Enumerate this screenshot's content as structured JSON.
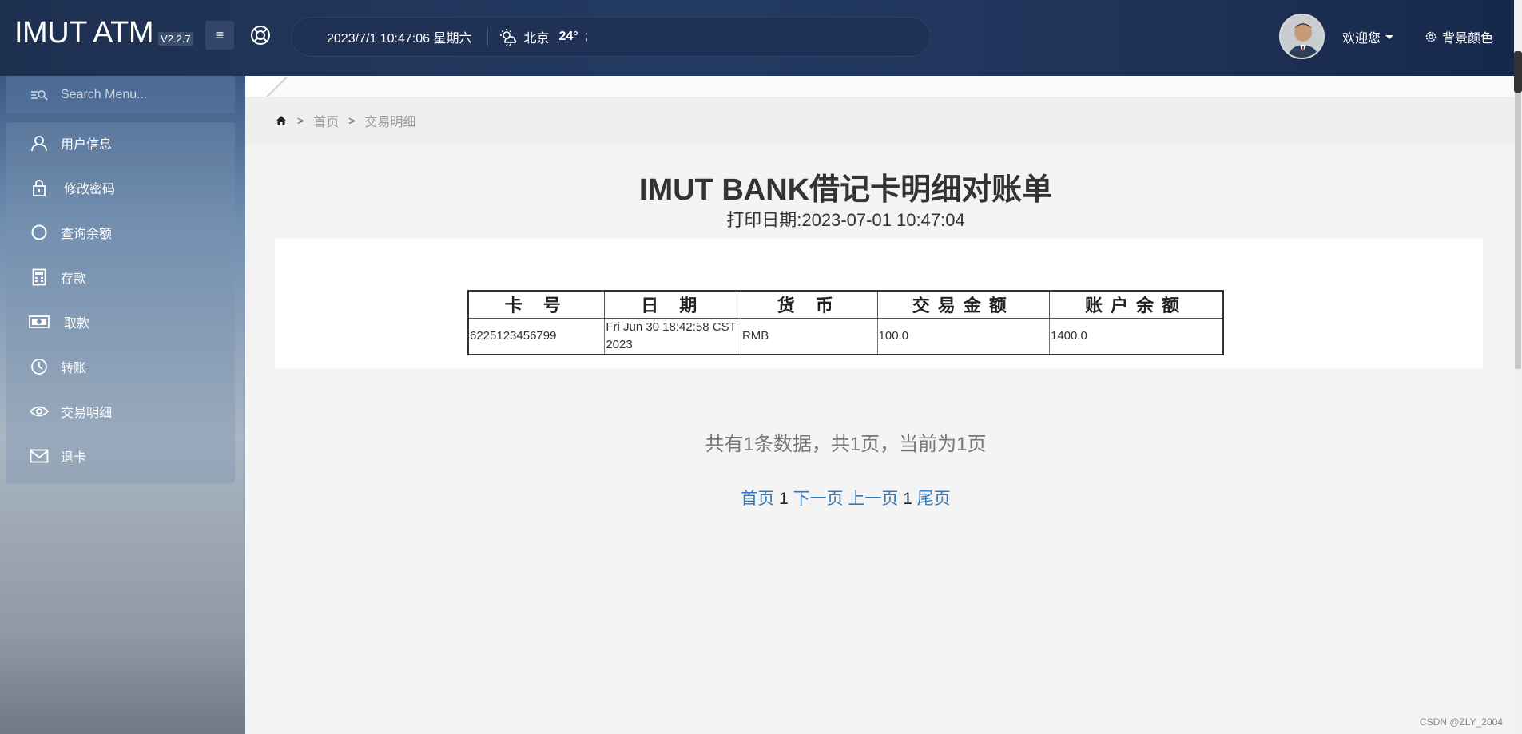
{
  "header": {
    "brand": "IMUT ATM",
    "version": "V2.2.7",
    "datetime": "2023/7/1 10:47:06 星期六",
    "city": "北京",
    "temperature": "24°",
    "temp_suffix": ";",
    "welcome": "欢迎您",
    "bg_color_label": "背景颜色"
  },
  "sidebar": {
    "search_placeholder": "Search Menu...",
    "items": [
      {
        "label": "用户信息",
        "icon": "user-icon"
      },
      {
        "label": "修改密码",
        "icon": "lock-icon"
      },
      {
        "label": "查询余额",
        "icon": "circle-icon"
      },
      {
        "label": "存款",
        "icon": "calculator-icon"
      },
      {
        "label": "取款",
        "icon": "money-icon"
      },
      {
        "label": "转账",
        "icon": "clock-icon"
      },
      {
        "label": "交易明细",
        "icon": "eye-icon"
      },
      {
        "label": "退卡",
        "icon": "envelope-icon"
      }
    ]
  },
  "breadcrumb": {
    "home": "首页",
    "current": "交易明细"
  },
  "statement": {
    "title": "IMUT BANK借记卡明细对账单",
    "print_date": "打印日期:2023-07-01 10:47:04",
    "columns": [
      "卡 号",
      "日 期",
      "货 币",
      "交易金额",
      "账户余额"
    ],
    "rows": [
      {
        "card": "6225123456799",
        "date": "Fri Jun 30 18:42:58 CST 2023",
        "currency": "RMB",
        "amount": "100.0",
        "balance": "1400.0"
      }
    ]
  },
  "pagination": {
    "summary": "共有1条数据，共1页，当前为1页",
    "first": "首页",
    "page_a": "1",
    "next": "下一页",
    "prev": "上一页",
    "page_b": "1",
    "last": "尾页"
  },
  "watermark": "CSDN @ZLY_2004",
  "colors": {
    "topbar": "#223a62",
    "link": "#3478b8"
  }
}
